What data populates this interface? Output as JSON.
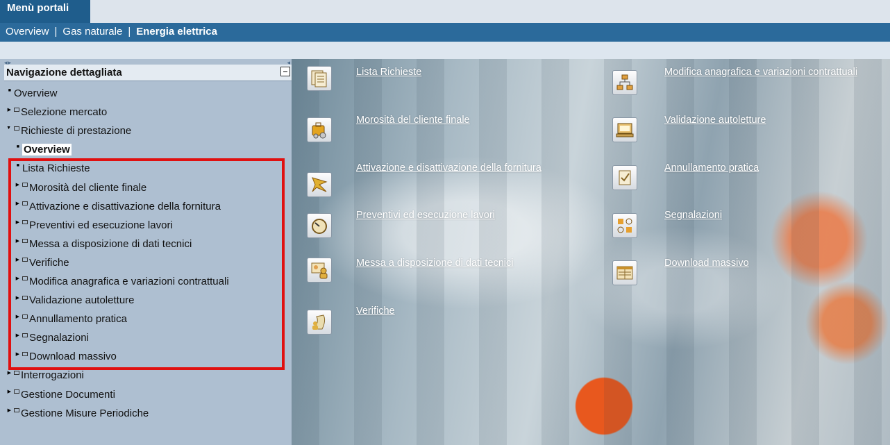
{
  "portal": {
    "title": "Menù portali"
  },
  "topnav": {
    "items": [
      "Overview",
      "Gas naturale",
      "Energia elettrica"
    ],
    "separator": "|"
  },
  "sidebar": {
    "header": "Navigazione dettagliata",
    "items": [
      {
        "label": "Overview",
        "level": 0
      },
      {
        "label": "Selezione mercato",
        "level": 0
      },
      {
        "label": "Richieste di prestazione",
        "level": 0
      },
      {
        "label": "Overview",
        "level": 1
      },
      {
        "label": "Lista Richieste",
        "level": 1
      },
      {
        "label": "Morosità del cliente finale",
        "level": 1
      },
      {
        "label": "Attivazione e disattivazione della fornitura",
        "level": 1
      },
      {
        "label": "Preventivi ed esecuzione lavori",
        "level": 1
      },
      {
        "label": "Messa a disposizione di dati tecnici",
        "level": 1
      },
      {
        "label": "Verifiche",
        "level": 1
      },
      {
        "label": "Modifica anagrafica e variazioni contrattuali",
        "level": 1
      },
      {
        "label": "Validazione autoletture",
        "level": 1
      },
      {
        "label": "Annullamento pratica",
        "level": 1
      },
      {
        "label": "Segnalazioni",
        "level": 1
      },
      {
        "label": "Download massivo",
        "level": 1
      },
      {
        "label": "Interrogazioni",
        "level": 0
      },
      {
        "label": "Gestione Documenti",
        "level": 0
      },
      {
        "label": "Gestione Misure Periodiche",
        "level": 0
      }
    ]
  },
  "main": {
    "left_links": [
      {
        "label": "Lista Richieste",
        "icon": "document-list-icon"
      },
      {
        "label": "Morosità del cliente finale",
        "icon": "luggage-coins-icon"
      },
      {
        "label": "Attivazione e disattivazione della fornitura",
        "icon": "star-burst-icon"
      },
      {
        "label": "Preventivi ed esecuzione lavori",
        "icon": "gauge-icon"
      },
      {
        "label": "Messa a disposizione di dati tecnici",
        "icon": "id-card-person-icon"
      },
      {
        "label": "Verifiche",
        "icon": "map-person-icon"
      }
    ],
    "right_links": [
      {
        "label": "Modifica anagrafica e variazioni contrattuali",
        "icon": "org-chart-icon"
      },
      {
        "label": "Validazione autoletture",
        "icon": "laptop-icon"
      },
      {
        "label": "Annullamento pratica",
        "icon": "notepad-check-icon"
      },
      {
        "label": "Segnalazioni",
        "icon": "shapes-grid-icon"
      },
      {
        "label": "Download massivo",
        "icon": "table-sheet-icon"
      }
    ]
  },
  "colors": {
    "portal_bar": "#1f5d8c",
    "nav_bar": "#2b6a9b",
    "sidebar": "#aebfd1",
    "highlight_border": "#e01010"
  }
}
